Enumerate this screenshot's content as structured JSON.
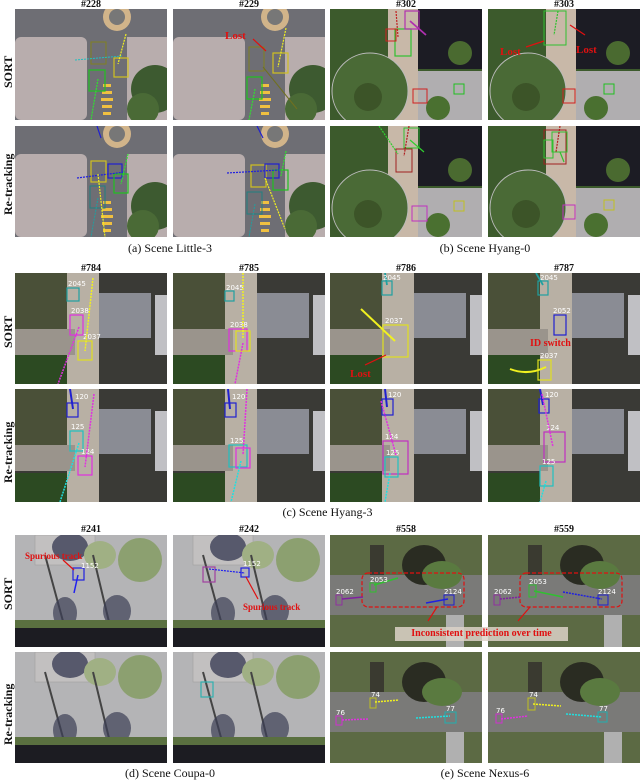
{
  "sections": {
    "a": {
      "caption": "(a) Scene Little-3",
      "frames": [
        "#228",
        "#229"
      ],
      "annotations": [
        "Lost"
      ]
    },
    "b": {
      "caption": "(b) Scene Hyang-0",
      "frames": [
        "#302",
        "#303"
      ],
      "annotations": [
        "Lost",
        "Lost"
      ]
    },
    "c": {
      "caption": "(c) Scene Hyang-3",
      "frames": [
        "#784",
        "#785",
        "#786",
        "#787"
      ],
      "annotations": [
        "Lost",
        "ID switch"
      ],
      "ids_sort": [
        "2045",
        "2038",
        "2037",
        "2052"
      ],
      "ids_retracking": [
        "120",
        "125",
        "124"
      ]
    },
    "d": {
      "caption": "(d) Scene Coupa-0",
      "frames": [
        "#241",
        "#242"
      ],
      "annotations": [
        "Spurious track",
        "Spurious track"
      ],
      "ids_sort": [
        "1152"
      ]
    },
    "e": {
      "caption": "(e) Scene Nexus-6",
      "frames": [
        "#558",
        "#559"
      ],
      "annotations": [
        "Inconsistent prediction over time"
      ],
      "ids_sort": [
        "2062",
        "2053",
        "2124"
      ],
      "ids_retracking": [
        "74",
        "76",
        "77"
      ]
    }
  },
  "row_labels": {
    "sort": "SORT",
    "retracking": "Re-tracking"
  }
}
